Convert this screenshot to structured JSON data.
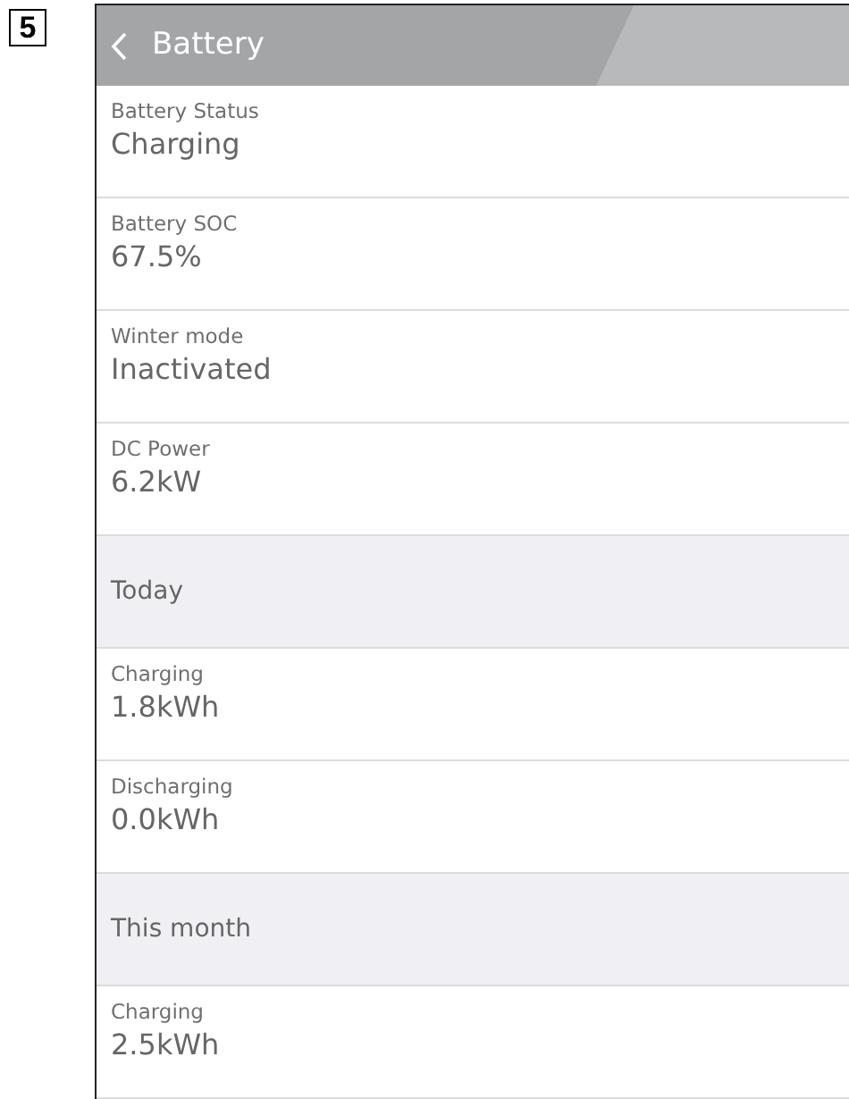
{
  "step_number": "5",
  "header": {
    "title": "Battery"
  },
  "rows": [
    {
      "kind": "item",
      "label": "Battery Status",
      "value": "Charging"
    },
    {
      "kind": "item",
      "label": "Battery SOC",
      "value": "67.5%"
    },
    {
      "kind": "item",
      "label": "Winter mode",
      "value": "Inactivated"
    },
    {
      "kind": "item",
      "label": "DC Power",
      "value": "6.2kW"
    },
    {
      "kind": "section",
      "label": "Today"
    },
    {
      "kind": "item",
      "label": "Charging",
      "value": "1.8kWh"
    },
    {
      "kind": "item",
      "label": "Discharging",
      "value": "0.0kWh"
    },
    {
      "kind": "section",
      "label": "This month"
    },
    {
      "kind": "item",
      "label": "Charging",
      "value": "2.5kWh"
    }
  ]
}
